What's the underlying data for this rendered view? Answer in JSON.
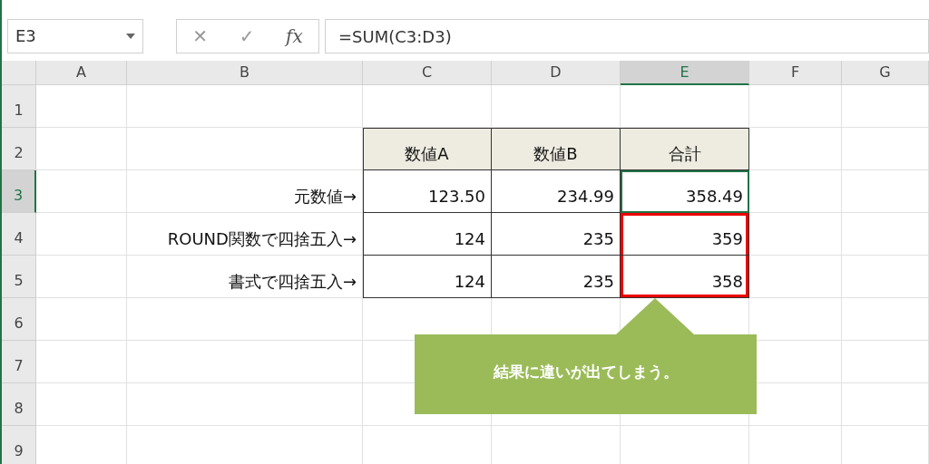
{
  "name_box": {
    "value": "E3"
  },
  "formula_buttons": [
    {
      "kind": "cancel",
      "label": "✕"
    },
    {
      "kind": "enter",
      "label": "✓"
    },
    {
      "kind": "function",
      "label": "fx"
    }
  ],
  "formula_bar": {
    "value": "=SUM(C3:D3)"
  },
  "columns": [
    {
      "label": "A",
      "selected": false
    },
    {
      "label": "B",
      "selected": false
    },
    {
      "label": "C",
      "selected": false
    },
    {
      "label": "D",
      "selected": false
    },
    {
      "label": "E",
      "selected": true
    },
    {
      "label": "F",
      "selected": false
    },
    {
      "label": "G",
      "selected": false
    }
  ],
  "rows": [
    {
      "label": "1",
      "selected": false
    },
    {
      "label": "2",
      "selected": false
    },
    {
      "label": "3",
      "selected": true
    },
    {
      "label": "4",
      "selected": false
    },
    {
      "label": "5",
      "selected": false
    },
    {
      "label": "6",
      "selected": false
    },
    {
      "label": "7",
      "selected": false
    },
    {
      "label": "8",
      "selected": false
    },
    {
      "label": "9",
      "selected": false
    }
  ],
  "data_table": {
    "header": [
      "数値A",
      "数値B",
      "合計"
    ],
    "rows": [
      {
        "label": "元数値→",
        "highlighted": false,
        "values": [
          {
            "text": "123.50",
            "selected": false
          },
          {
            "text": "234.99",
            "selected": false
          },
          {
            "text": "358.49",
            "selected": true
          }
        ]
      },
      {
        "label": "ROUND関数で四捨五入→",
        "highlighted": true,
        "values": [
          {
            "text": "124",
            "selected": false
          },
          {
            "text": "235",
            "selected": false
          },
          {
            "text": "359",
            "selected": false
          }
        ]
      },
      {
        "label": "書式で四捨五入→",
        "highlighted": true,
        "values": [
          {
            "text": "124",
            "selected": false
          },
          {
            "text": "235",
            "selected": false
          },
          {
            "text": "358",
            "selected": false
          }
        ]
      }
    ]
  },
  "callout": {
    "text": "結果に違いが出てしまう。"
  }
}
